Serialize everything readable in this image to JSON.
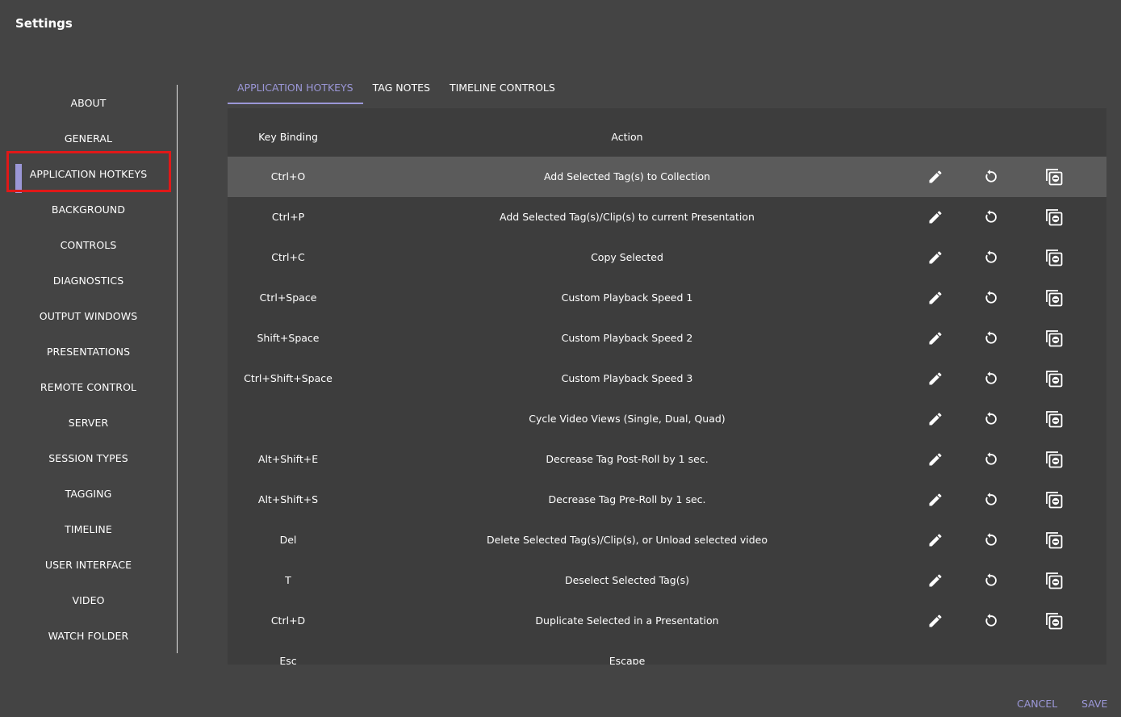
{
  "window": {
    "title": "Settings"
  },
  "sidebar": {
    "items": [
      {
        "label": "ABOUT"
      },
      {
        "label": "GENERAL"
      },
      {
        "label": "APPLICATION HOTKEYS",
        "active": true
      },
      {
        "label": "BACKGROUND"
      },
      {
        "label": "CONTROLS"
      },
      {
        "label": "DIAGNOSTICS"
      },
      {
        "label": "OUTPUT WINDOWS"
      },
      {
        "label": "PRESENTATIONS"
      },
      {
        "label": "REMOTE CONTROL"
      },
      {
        "label": "SERVER"
      },
      {
        "label": "SESSION TYPES"
      },
      {
        "label": "TAGGING"
      },
      {
        "label": "TIMELINE"
      },
      {
        "label": "USER INTERFACE"
      },
      {
        "label": "VIDEO"
      },
      {
        "label": "WATCH FOLDER"
      }
    ]
  },
  "tabs": [
    {
      "label": "APPLICATION HOTKEYS",
      "active": true
    },
    {
      "label": "TAG NOTES"
    },
    {
      "label": "TIMELINE CONTROLS"
    }
  ],
  "table": {
    "headers": {
      "key": "Key Binding",
      "action": "Action"
    },
    "rows": [
      {
        "key": "Ctrl+O",
        "action": "Add Selected Tag(s) to Collection",
        "selected": true
      },
      {
        "key": "Ctrl+P",
        "action": "Add Selected Tag(s)/Clip(s) to current Presentation"
      },
      {
        "key": "Ctrl+C",
        "action": "Copy Selected"
      },
      {
        "key": "Ctrl+Space",
        "action": "Custom Playback Speed 1"
      },
      {
        "key": "Shift+Space",
        "action": "Custom Playback Speed 2"
      },
      {
        "key": "Ctrl+Shift+Space",
        "action": "Custom Playback Speed 3"
      },
      {
        "key": "",
        "action": "Cycle Video Views (Single, Dual, Quad)"
      },
      {
        "key": "Alt+Shift+E",
        "action": "Decrease Tag Post-Roll by 1 sec."
      },
      {
        "key": "Alt+Shift+S",
        "action": "Decrease Tag Pre-Roll by 1 sec."
      },
      {
        "key": "Del",
        "action": "Delete Selected Tag(s)/Clip(s), or Unload selected video"
      },
      {
        "key": "T",
        "action": "Deselect Selected Tag(s)"
      },
      {
        "key": "Ctrl+D",
        "action": "Duplicate Selected in a Presentation"
      },
      {
        "key": "Esc",
        "action": "Escape"
      }
    ],
    "row_icons": [
      "pencil-icon",
      "reset-icon",
      "clear-binding-icon"
    ]
  },
  "footer": {
    "cancel_label": "CANCEL",
    "save_label": "SAVE"
  },
  "colors": {
    "background": "#444444",
    "panel": "#3d3d3d",
    "selected_row": "#5b5b5b",
    "accent": "#9b97d7",
    "highlight": "#e01818"
  }
}
